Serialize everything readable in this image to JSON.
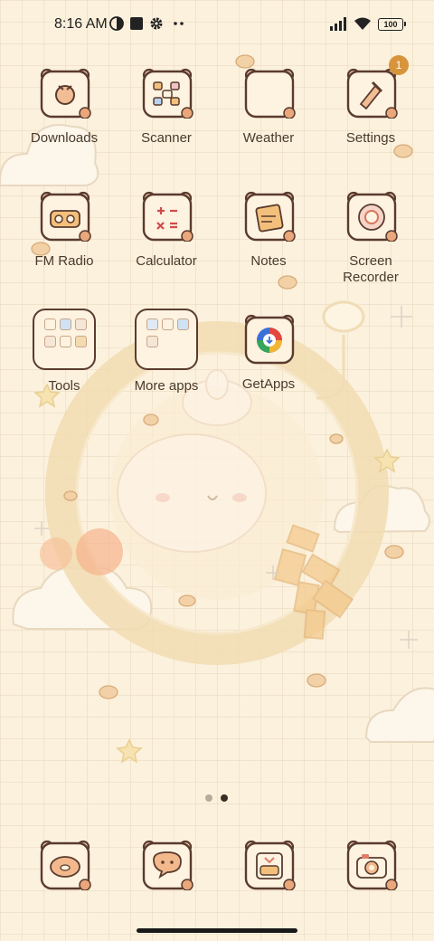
{
  "status_bar": {
    "time": "8:16 AM",
    "battery": "100",
    "left_icons": [
      "data-saver-icon",
      "square-notification-icon",
      "gear-icon",
      "more-dots-icon"
    ],
    "right_icons": [
      "cellular-signal-icon",
      "wifi-icon",
      "battery-icon"
    ]
  },
  "apps": [
    {
      "label": "Downloads",
      "icon": "downloads-icon"
    },
    {
      "label": "Scanner",
      "icon": "scanner-icon"
    },
    {
      "label": "Weather",
      "icon": "weather-icon"
    },
    {
      "label": "Settings",
      "icon": "settings-icon",
      "badge": "1"
    },
    {
      "label": "FM Radio",
      "icon": "radio-icon"
    },
    {
      "label": "Calculator",
      "icon": "calculator-icon"
    },
    {
      "label": "Notes",
      "icon": "notes-icon"
    },
    {
      "label": "Screen Recorder",
      "label_line1": "Screen",
      "label_line2": "Recorder",
      "icon": "screen-recorder-icon"
    },
    {
      "label": "Tools",
      "icon": "folder-icon"
    },
    {
      "label": "More apps",
      "icon": "folder-icon"
    },
    {
      "label": "GetApps",
      "icon": "getapps-icon"
    }
  ],
  "dock": [
    {
      "icon": "phone-icon"
    },
    {
      "icon": "messages-icon"
    },
    {
      "icon": "gallery-icon"
    },
    {
      "icon": "camera-icon"
    }
  ],
  "pages": {
    "total": 2,
    "current": 2
  },
  "colors": {
    "background": "#fbf1dd",
    "icon_border": "#5a3b2e",
    "icon_fill": "#fdf3e0",
    "label": "#4a3a2c",
    "badge": "#d8943a",
    "accent_peach": "#e9a77b"
  }
}
